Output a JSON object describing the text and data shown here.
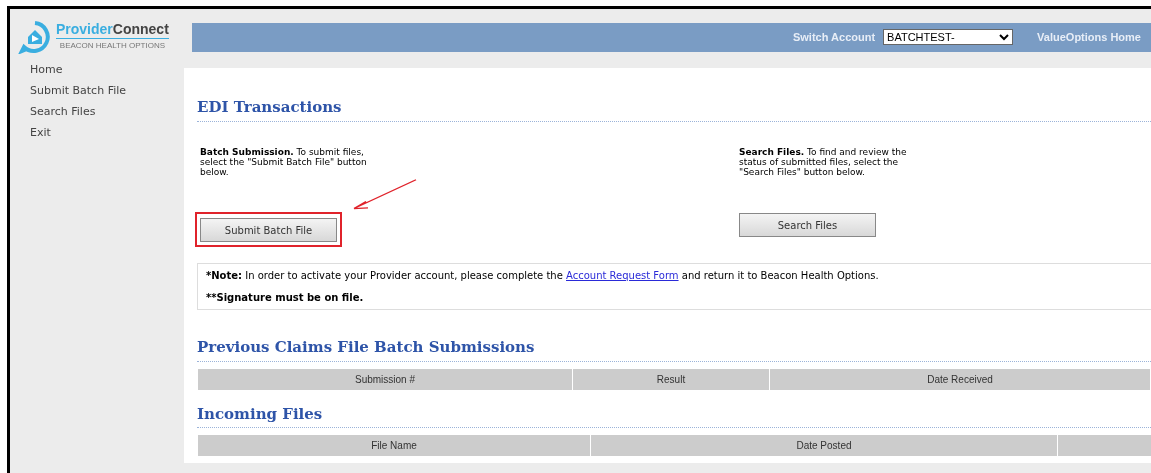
{
  "logo": {
    "name_part1": "Provider",
    "name_part2": "Connect",
    "tagline": "BEACON HEALTH OPTIONS"
  },
  "header": {
    "switch_label": "Switch Account",
    "account": "BATCHTEST-",
    "home_link": "ValueOptions Home"
  },
  "sidebar": {
    "items": [
      {
        "label": "Home"
      },
      {
        "label": "Submit Batch File"
      },
      {
        "label": "Search Files"
      },
      {
        "label": "Exit"
      }
    ]
  },
  "edi": {
    "title": "EDI Transactions",
    "cards": [
      {
        "lead": "Batch Submission.",
        "text": "To submit files, select the \"Submit Batch File\" button below.",
        "button": "Submit Batch File",
        "highlighted": true
      },
      {
        "lead": "Search Files.",
        "text": "To find and review the status of submitted files, select the \"Search Files\" button below.",
        "button": "Search Files",
        "highlighted": false
      }
    ]
  },
  "note": {
    "lead": "*Note:",
    "before": "In order to activate your Provider account, please complete the",
    "link": "Account Request Form",
    "after": "and return it to Beacon Health Options.",
    "signature": "**Signature must be on file."
  },
  "tables": [
    {
      "title": "Previous Claims File Batch Submissions",
      "columns": [
        "Submission #",
        "Result",
        "Date Received"
      ]
    },
    {
      "title": "Incoming Files",
      "columns": [
        "File Name",
        "Date Posted"
      ]
    }
  ]
}
